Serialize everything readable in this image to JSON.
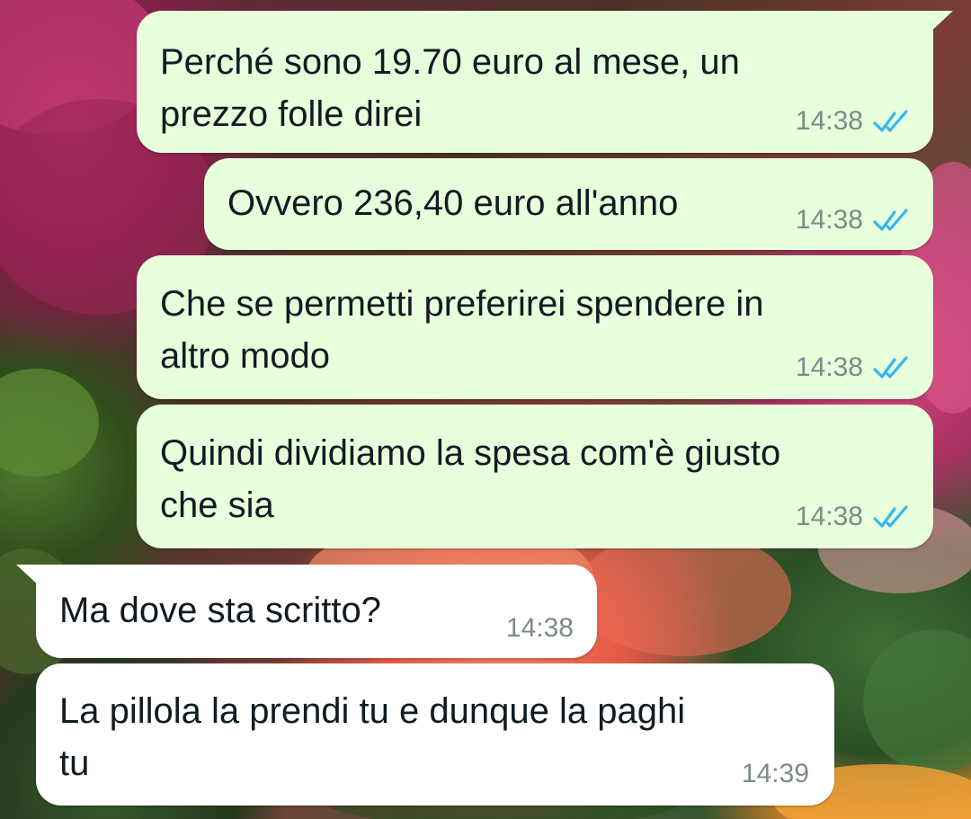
{
  "chat": {
    "messages": [
      {
        "direction": "outgoing",
        "text": "Perché sono 19.70 euro al mese, un\nprezzo folle direi",
        "time": "14:38",
        "status": "read",
        "status_icon": "double-check-icon"
      },
      {
        "direction": "outgoing",
        "text": "Ovvero 236,40 euro all'anno",
        "time": "14:38",
        "status": "read",
        "status_icon": "double-check-icon"
      },
      {
        "direction": "outgoing",
        "text": "Che se permetti preferirei spendere in\naltro modo",
        "time": "14:38",
        "status": "read",
        "status_icon": "double-check-icon"
      },
      {
        "direction": "outgoing",
        "text": "Quindi dividiamo la spesa com'è giusto\nche sia",
        "time": "14:38",
        "status": "read",
        "status_icon": "double-check-icon"
      },
      {
        "direction": "incoming",
        "text": "Ma dove sta scritto?",
        "time": "14:38"
      },
      {
        "direction": "incoming",
        "text": "La pillola la prendi tu e dunque la paghi\ntu",
        "time": "14:39"
      }
    ]
  },
  "colors": {
    "outgoing_bubble": "#e7ffdb",
    "incoming_bubble": "#ffffff",
    "read_ticks": "#34b7f1",
    "timestamp": "#7d8a87"
  }
}
